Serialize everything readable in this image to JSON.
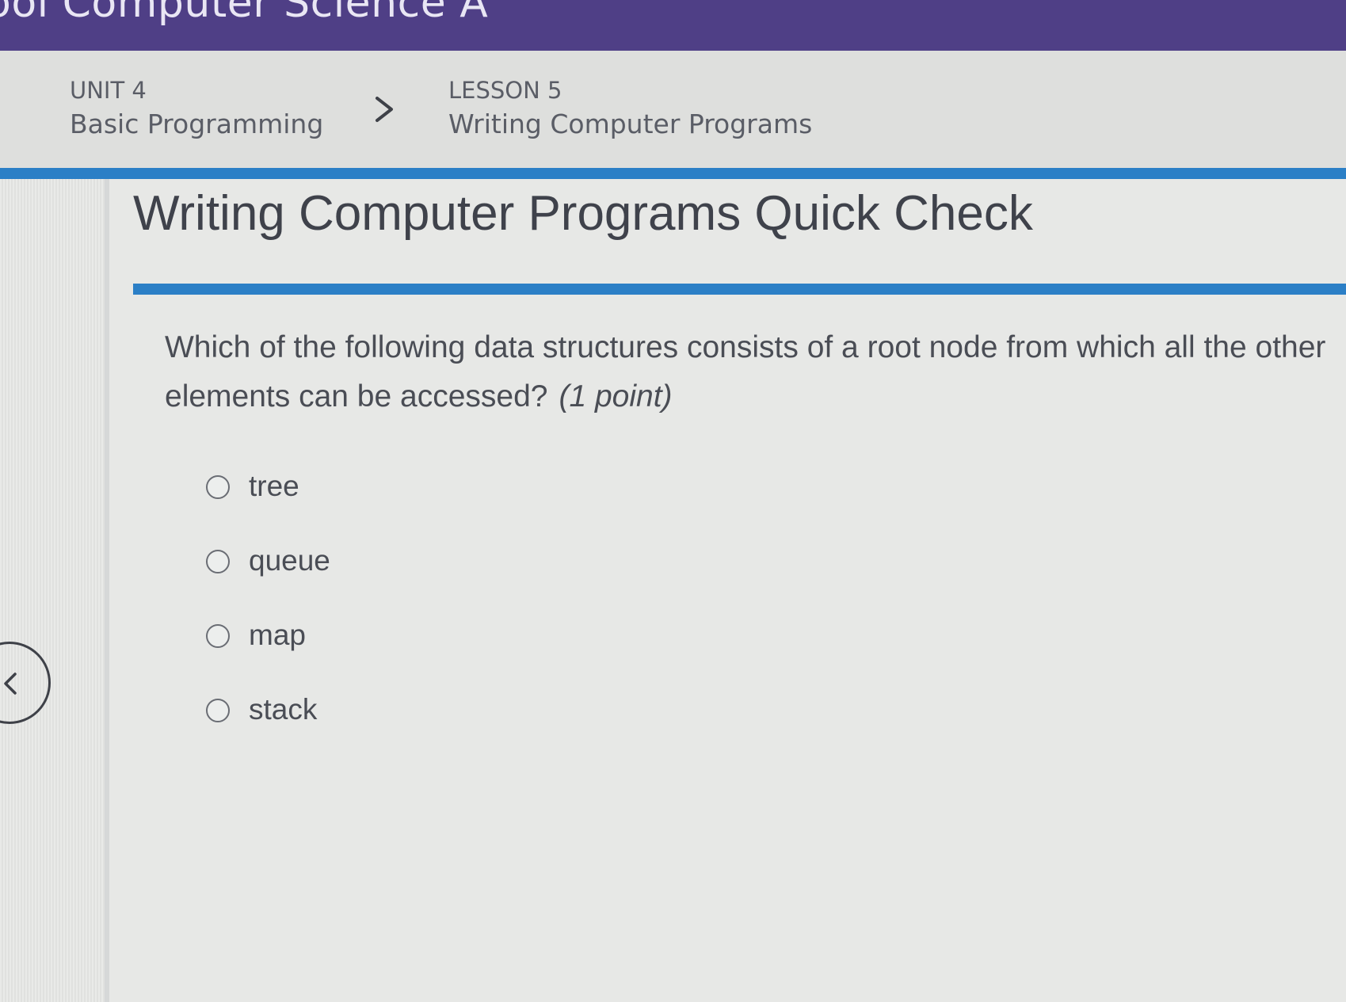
{
  "header": {
    "app_title": "ool Computer Science A"
  },
  "breadcrumb": {
    "unit_label": "UNIT 4",
    "unit_title": "Basic Programming",
    "separator_icon": "chevron-right-icon",
    "lesson_label": "LESSON 5",
    "lesson_title": "Writing Computer Programs"
  },
  "page": {
    "title": "Writing Computer Programs Quick Check"
  },
  "question": {
    "text": "Which of the following data structures consists of a root node from which all the other elements can be accessed?",
    "points": "(1 point)",
    "options": [
      {
        "label": "tree",
        "selected": false
      },
      {
        "label": "queue",
        "selected": false
      },
      {
        "label": "map",
        "selected": false
      },
      {
        "label": "stack",
        "selected": false
      }
    ]
  },
  "navigation": {
    "back_icon": "chevron-left-icon"
  },
  "colors": {
    "header_bg": "#4f3f86",
    "accent_blue": "#2b7fc6",
    "page_bg": "#e4e5e3",
    "text": "#4a4d55"
  }
}
